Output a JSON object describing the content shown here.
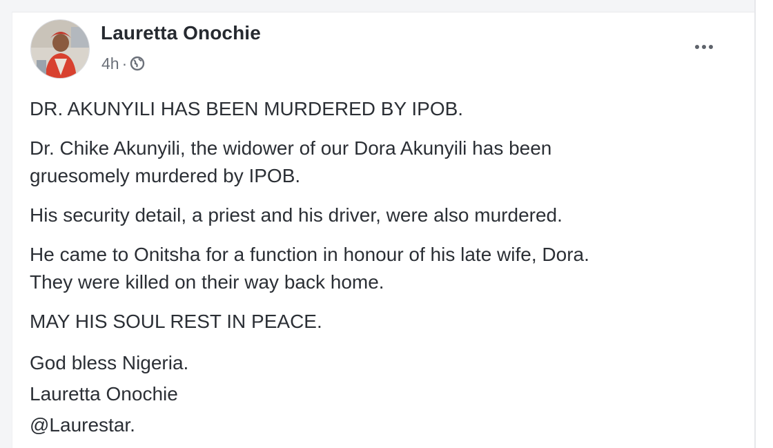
{
  "post": {
    "author": "Lauretta Onochie",
    "time": "4h",
    "separator": "·",
    "privacy_icon": "globe-icon",
    "more_icon": "more-options-icon",
    "paragraphs": [
      {
        "lines": [
          "DR. AKUNYILI HAS BEEN MURDERED BY IPOB."
        ]
      },
      {
        "lines": [
          "Dr. Chike Akunyili, the widower of our Dora Akunyili has been",
          "gruesomely murdered by IPOB."
        ]
      },
      {
        "lines": [
          "His security detail, a priest and his driver, were also murdered."
        ]
      },
      {
        "lines": [
          "He came to Onitsha for a function in honour of his late wife, Dora.",
          "They were killed on their way back home."
        ]
      },
      {
        "lines": [
          "MAY HIS SOUL REST IN PEACE."
        ]
      }
    ],
    "signature": [
      "God bless Nigeria.",
      "Lauretta Onochie",
      "@Laurestar."
    ]
  },
  "colors": {
    "text": "#2b2f35",
    "meta": "#6b7079",
    "author": "#262a30"
  }
}
